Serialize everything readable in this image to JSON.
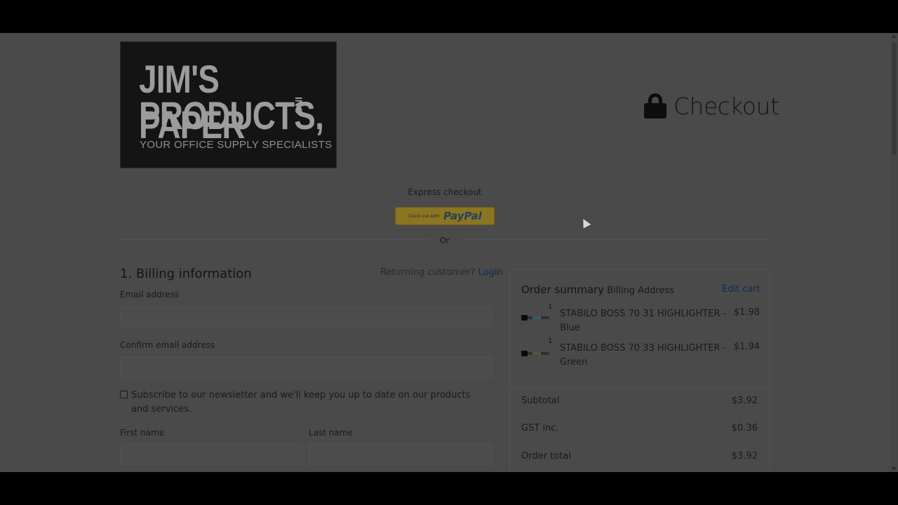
{
  "logo": {
    "line1": "JIM'S PAPER",
    "line2": "PRODUCTS,",
    "inc": "INC",
    "tagline": "YOUR OFFICE SUPPLY SPECIALISTS"
  },
  "header": {
    "title": "Checkout",
    "icon": "lock-icon"
  },
  "express": {
    "label": "Express checkout",
    "paypal_small": "Check out with",
    "paypal_brand_a": "Pay",
    "paypal_brand_b": "Pal",
    "or": "Or"
  },
  "billing": {
    "title": "1. Billing information",
    "returning_text": "Returning customer?",
    "login_link": "Login",
    "email_label": "Email address",
    "email_value": "",
    "confirm_email_label": "Confirm email address",
    "confirm_email_value": "",
    "subscribe_text": "Subscribe to our newsletter and we'll keep you up to date on our products and services.",
    "first_name_label": "First name",
    "last_name_label": "Last name"
  },
  "summary": {
    "title": "Order summary",
    "subtitle": "Billing Address",
    "edit_cart": "Edit cart",
    "items": [
      {
        "qty": "1",
        "name": "STABILO BOSS 70 31 HIGHLIGHTER - Blue",
        "price": "$1.98",
        "color": "#3a5a6a"
      },
      {
        "qty": "1",
        "name": "STABILO BOSS 70 33 HIGHLIGHTER - Green",
        "price": "$1.94",
        "color": "#4a5a3a"
      }
    ],
    "subtotal_label": "Subtotal",
    "subtotal_value": "$3.92",
    "gst_label": "GST inc.",
    "gst_value": "$0.36",
    "total_label": "Order total",
    "total_value": "$3.92"
  },
  "colors": {
    "overlay_bg": "#4a4a4a",
    "link": "#0e2a54",
    "paypal": "#8a7520"
  }
}
